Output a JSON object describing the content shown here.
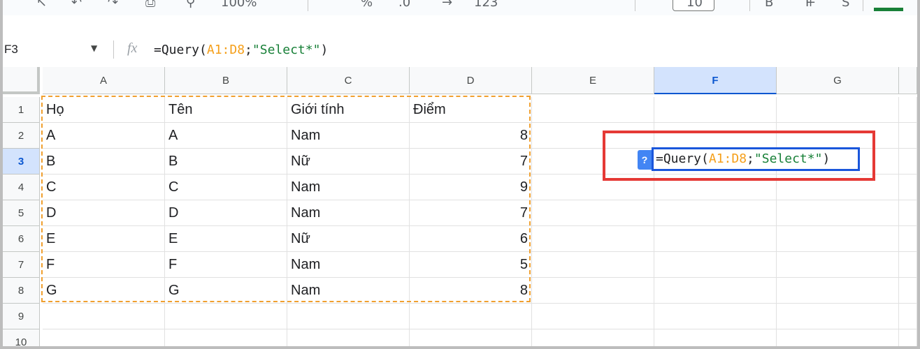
{
  "toolbar": {
    "items": [
      "↖",
      "↶",
      "↷",
      "⎙",
      "⚲",
      "100%",
      "₫",
      "%",
      ".0",
      "←",
      "→",
      "123",
      "10",
      "+",
      "B",
      "I",
      "S"
    ],
    "font_size_value": "10",
    "zoom_label": "100%"
  },
  "formula_bar": {
    "name_box": "F3",
    "fx_label": "fx",
    "formula_parts": [
      {
        "text": "=Query(",
        "color": "dark"
      },
      {
        "text": "A1:D8",
        "color": "orange"
      },
      {
        "text": ";",
        "color": "dark"
      },
      {
        "text": "\"Select*\"",
        "color": "green"
      },
      {
        "text": ")",
        "color": "dark"
      }
    ]
  },
  "grid": {
    "columns": [
      "A",
      "B",
      "C",
      "D",
      "E",
      "F",
      "G"
    ],
    "selected_column": "F",
    "rows": [
      "1",
      "2",
      "3",
      "4",
      "5",
      "6",
      "7",
      "8",
      "9",
      "10"
    ],
    "selected_row": "3",
    "data": [
      [
        "Họ",
        "Tên",
        "Giới tính",
        "Điểm"
      ],
      [
        "A",
        "A",
        "Nam",
        "8"
      ],
      [
        "B",
        "B",
        "Nữ",
        "7"
      ],
      [
        "C",
        "C",
        "Nam",
        "9"
      ],
      [
        "D",
        "D",
        "Nam",
        "7"
      ],
      [
        "E",
        "E",
        "Nữ",
        "6"
      ],
      [
        "F",
        "F",
        "Nam",
        "5"
      ],
      [
        "G",
        "G",
        "Nam",
        "8"
      ]
    ],
    "referenced_range": "A1:D8"
  },
  "editor": {
    "help_label": "?",
    "active_cell": "F3"
  },
  "colors": {
    "accent": "#1a56db",
    "highlight": "#e53935",
    "range": "#f0a030",
    "formula_orange": "#f59f1a",
    "formula_green": "#188038"
  }
}
